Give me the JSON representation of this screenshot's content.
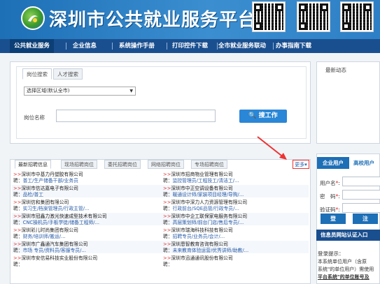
{
  "site": {
    "title": "深圳市公共就业服务平台"
  },
  "nav": {
    "items": [
      "公共就业服务",
      "企业信息",
      "系统操作手册",
      "打印控件下载",
      "全市就业服务联动",
      "办事指南下载"
    ]
  },
  "search": {
    "tabs": [
      "岗位搜索",
      "人才搜索"
    ],
    "region_select": "选择区域(默认全市)",
    "position_label": "岗位名称",
    "button": "搜工作"
  },
  "news": {
    "title": "最新动态"
  },
  "jobs": {
    "tabs": [
      "最新招聘信息",
      "现场招聘岗位",
      "委托招聘岗位",
      "网络招聘岗位",
      "专场招聘岗位"
    ],
    "more": "更多",
    "left": [
      {
        "company": "深圳市中基力丹塑胶有限公司",
        "positions": "普工/生产储备干部/业务员"
      },
      {
        "company": "深圳市信达嘉电子有限公司",
        "positions": "品检/普工"
      },
      {
        "company": "深圳信和集团有限公司",
        "positions": "实习生/档案管理员/行政主管/..."
      },
      {
        "company": "深圳市冠鑫力激光快速成型技术有限公司",
        "positions": "CNC操机员/手板学徒/储备工程师/..."
      },
      {
        "company": "深圳彩儿时尚集团有限公司",
        "positions": "财务/培训师/搬运/..."
      },
      {
        "company": "深圳市广鑫通汽车集团有限公司",
        "positions": "市场 专员/资料员/客服专员/..."
      },
      {
        "company": "深圳市安信易科技实业股份有限公司",
        "positions": ""
      }
    ],
    "right": [
      {
        "company": "深圳市招商物业管理有限公司",
        "positions": "监控管理员/工程技工/清洁工/..."
      },
      {
        "company": "深圳市中正空调设备有限公司",
        "positions": "暖通设计师/家装项目经理/导购/..."
      },
      {
        "company": "深圳市中深力人力资源管理有限公司",
        "positions": "行政前台/SQE品管/行政专员/..."
      },
      {
        "company": "深圳市中企工联保家电服务有限公司",
        "positions": "高层策划师/前台门店/售后专员/..."
      },
      {
        "company": "深圳市瑞海科技科技有限公司",
        "positions": "招聘专员/业务员/会计/..."
      },
      {
        "company": "深圳恩智教育咨询有限公司",
        "positions": "未来教育体验运营/优秀讲师/助教/..."
      },
      {
        "company": "深圳市迅通通讯股份有限公司",
        "positions": ""
      }
    ],
    "hire_prefix": "聘：",
    "row_prefix": ">>"
  },
  "login": {
    "tab_company": "企业用户",
    "tab_school": "高校用户",
    "username_label": "用户名",
    "password_label": "密　码",
    "captcha_label": "验证码",
    "register_button": "登",
    "login_button": "注",
    "enter_button": "信息员网站认证入口",
    "tip_title": "登录提示：",
    "tips": [
      "本系统单位用户（含原",
      "系统\"的单位用户）需使用",
      "平台系统\"的单位账号及"
    ]
  },
  "colors": {
    "brand": "#1d6fb6",
    "nav": "#1a4f8f",
    "accent": "#2a86d6",
    "alert": "#e33333"
  }
}
